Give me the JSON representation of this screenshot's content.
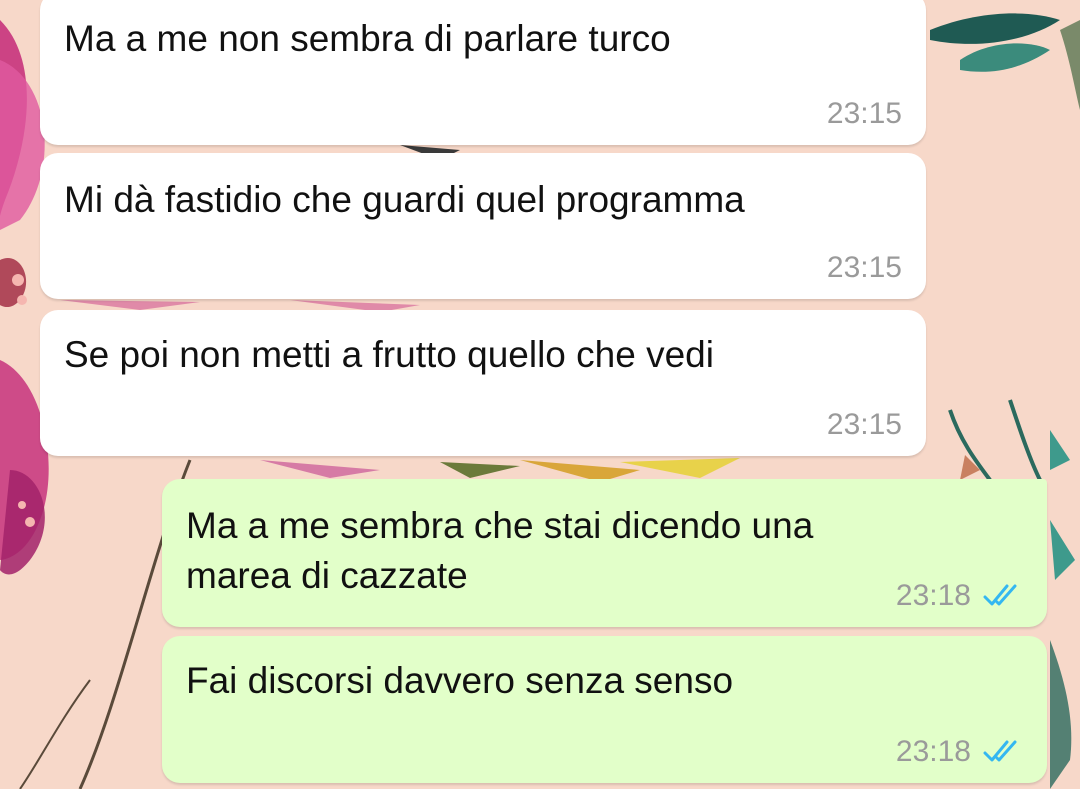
{
  "chat": {
    "messages": [
      {
        "direction": "incoming",
        "text": "Ma a me non sembra di parlare turco",
        "time": "23:15"
      },
      {
        "direction": "incoming",
        "text": "Mi dà fastidio che guardi quel programma",
        "time": "23:15"
      },
      {
        "direction": "incoming",
        "text": "Se poi non metti a frutto quello che vedi",
        "time": "23:15"
      },
      {
        "direction": "outgoing",
        "text": "Ma a me sembra che stai dicendo una marea di cazzate",
        "time": "23:18",
        "status": "read",
        "status_icon": "double-check-icon"
      },
      {
        "direction": "outgoing",
        "text": "Fai discorsi davvero senza senso",
        "time": "23:18",
        "status": "read",
        "status_icon": "double-check-icon"
      }
    ]
  },
  "theme": {
    "incoming_bubble": "#ffffff",
    "outgoing_bubble": "#e2ffc9",
    "timestamp_color": "#9a9a9a",
    "read_tick_color": "#34b7f1",
    "wallpaper_base": "#f7d8c9"
  }
}
